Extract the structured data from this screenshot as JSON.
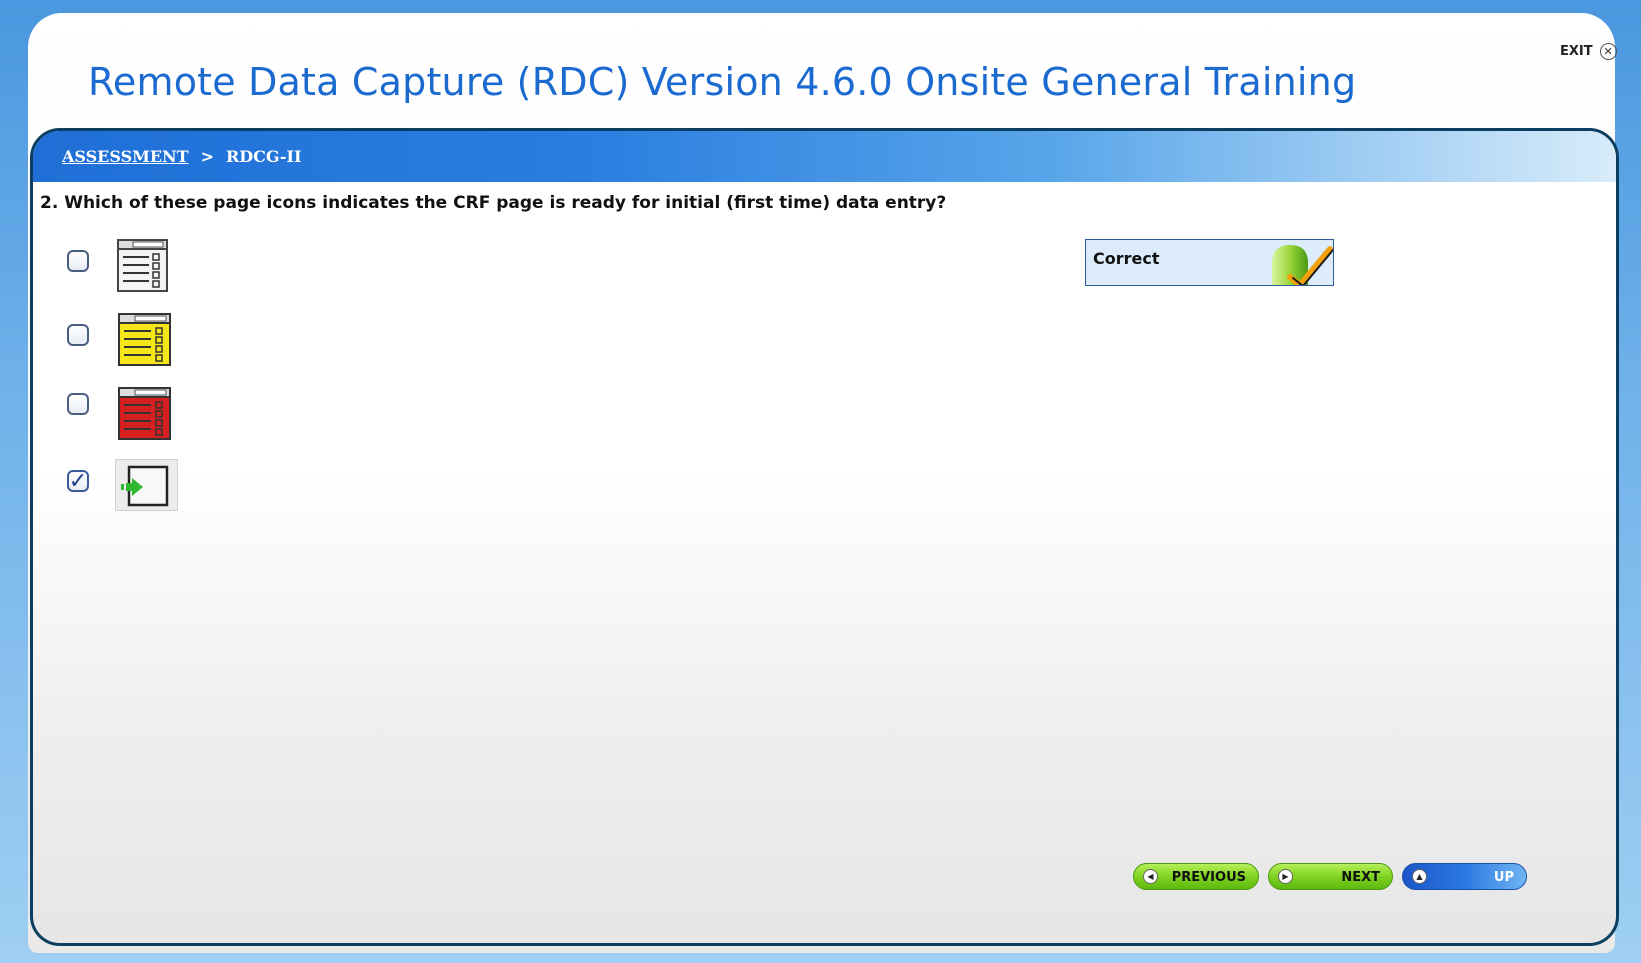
{
  "header": {
    "title": "Remote Data Capture (RDC) Version 4.6.0 Onsite General Training",
    "exit_label": "EXIT",
    "exit_icon": "close-circle-icon"
  },
  "breadcrumb": {
    "items": [
      {
        "label": "ASSESSMENT",
        "link": true
      },
      {
        "label": "RDCG-II",
        "link": false
      }
    ],
    "separator": ">"
  },
  "question": {
    "text": "2. Which of these page icons indicates the CRF page is ready for initial (first time) data entry?",
    "options": [
      {
        "icon": "crf-page-white-icon",
        "color": "#ffffff",
        "checked": false
      },
      {
        "icon": "crf-page-yellow-icon",
        "color": "#f5e61a",
        "checked": false
      },
      {
        "icon": "crf-page-red-icon",
        "color": "#d62020",
        "checked": false
      },
      {
        "icon": "crf-page-entry-arrow-icon",
        "color": "#2fb82f",
        "checked": true
      }
    ]
  },
  "feedback": {
    "label": "Correct",
    "icon": "correct-checkmark-icon"
  },
  "nav": {
    "previous_label": "PREVIOUS",
    "next_label": "NEXT",
    "up_label": "UP"
  },
  "colors": {
    "title": "#1a6ad0",
    "breadcrumb_bar": "#1f6fd6",
    "frame_border": "#0b3e61",
    "nav_green": "#7fd321",
    "nav_blue": "#2c78e2",
    "feedback_bg": "#dcecfb"
  }
}
